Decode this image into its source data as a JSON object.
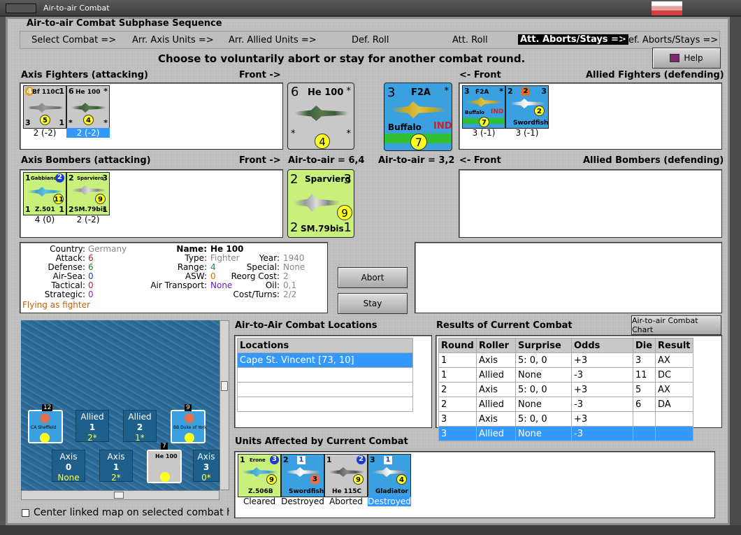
{
  "window": {
    "title": "Air-to-air Combat"
  },
  "sequence": {
    "title": "Air-to-air Combat Subphase Sequence",
    "steps": [
      "Select Combat =>",
      "Arr. Axis Units =>",
      "Arr. Allied Units =>",
      "Def. Roll",
      "Att. Roll",
      "Att. Aborts/Stays =>",
      "Def. Aborts/Stays =>"
    ],
    "active_index": 5
  },
  "prompt": "Choose to voluntarily abort or stay for another combat round.",
  "help_label": "Help",
  "axis_fighters": {
    "title": "Axis Fighters (attacking)",
    "front": "Front ->",
    "units": [
      {
        "name": "Bf 110C",
        "tl": "4",
        "tr": "1",
        "bl": "3",
        "br": "1",
        "dot": "5",
        "caption": "2 (-2)"
      },
      {
        "name": "He 100",
        "tl": "6",
        "tr": "*",
        "bl": "*",
        "br": "*",
        "dot": "4",
        "caption": "2 (-2)",
        "selected": true
      }
    ]
  },
  "allied_fighters": {
    "title": "Allied Fighters (defending)",
    "front": "<- Front",
    "units": [
      {
        "name": "F2A",
        "sub": "Buffalo",
        "tag": "IND",
        "tl": "3",
        "tr": "*",
        "dot": "7",
        "caption": "3 (-1)"
      },
      {
        "name": "Swordfish",
        "tl": "2",
        "tr": "3",
        "mid": "2",
        "dot": "2",
        "caption": "3 (-1)"
      }
    ]
  },
  "active_axis": {
    "name": "He 100",
    "tl": "6",
    "tr": "*",
    "bl": "*",
    "br": "*",
    "dot": "4",
    "odds_label": "Air-to-air = 6,4"
  },
  "active_allied": {
    "name": "F2A",
    "sub": "Buffalo",
    "tag": "IND",
    "tl": "3",
    "tr": "*",
    "dot": "7",
    "odds_label": "Air-to-air = 3,2"
  },
  "axis_bombers": {
    "title": "Axis Bombers (attacking)",
    "front": "Front ->",
    "units": [
      {
        "name": "Gabbiano",
        "sub": "Z.501",
        "tl": "1",
        "tr": "2",
        "bl": "1",
        "br": "1",
        "dot": "11",
        "caption": "4 (0)"
      },
      {
        "name": "Sparviero",
        "sub": "SM.79bis",
        "tl": "2",
        "tr": "3",
        "bl": "2",
        "br": "1",
        "dot": "9",
        "caption": "2 (-2)"
      }
    ]
  },
  "allied_bombers": {
    "title": "Allied Bombers (defending)",
    "front": "<- Front"
  },
  "active_bomber": {
    "name": "Sparviero",
    "sub": "SM.79bis",
    "tl": "2",
    "tr": "3",
    "bl": "2",
    "br": "1",
    "dot": "9"
  },
  "info": {
    "country_label": "Country:",
    "country": "Germany",
    "attack_label": "Attack:",
    "attack": "6",
    "defense_label": "Defense:",
    "defense": "6",
    "airsea_label": "Air-Sea:",
    "airsea": "0",
    "tactical_label": "Tactical:",
    "tactical": "0",
    "strategic_label": "Strategic:",
    "strategic": "0",
    "flying": "Flying as fighter",
    "name_label": "Name:",
    "name": "He 100",
    "type_label": "Type:",
    "type": "Fighter",
    "range_label": "Range:",
    "range": "4",
    "asw_label": "ASW:",
    "asw": "0",
    "transport_label": "Air Transport:",
    "transport": "None",
    "year_label": "Year:",
    "year": "1940",
    "special_label": "Special:",
    "special": "None",
    "reorg_label": "Reorg Cost:",
    "reorg": "2",
    "oil_label": "Oil:",
    "oil": "0,1",
    "cost_label": "Cost/Turns:",
    "cost": "2/2"
  },
  "abort_label": "Abort",
  "stay_label": "Stay",
  "map": {
    "hexes": [
      {
        "side": "Allied",
        "n": "1",
        "v": "2*"
      },
      {
        "side": "Allied",
        "n": "2",
        "v": "1*"
      },
      {
        "side": "Axis",
        "n": "0",
        "v": "None"
      },
      {
        "side": "Axis",
        "n": "1",
        "v": "2*"
      },
      {
        "side": "Axis",
        "n": "3",
        "v": "0*"
      }
    ],
    "ships": [
      {
        "name": "CA Sheffield",
        "stack": "12"
      },
      {
        "name": "BB Duke of York",
        "stack": "9"
      }
    ],
    "map_counter": {
      "name": "He 100",
      "stack": "7"
    },
    "center_label": "Center linked map on selected combat hex"
  },
  "locations": {
    "title": "Air-to-Air Combat Locations",
    "header": "Locations",
    "items": [
      "Cape St. Vincent [73, 10]"
    ]
  },
  "results": {
    "title": "Results of Current Combat",
    "chart_button": "Air-to-air Combat Chart",
    "columns": [
      "Round",
      "Roller",
      "Surprise",
      "Odds",
      "Die",
      "Result"
    ],
    "rows": [
      [
        "1",
        "Axis",
        "5: 0, 0",
        "+3",
        "3",
        "AX"
      ],
      [
        "1",
        "Allied",
        "None",
        "-3",
        "11",
        "DC"
      ],
      [
        "2",
        "Axis",
        "5: 0, 0",
        "+3",
        "5",
        "AX"
      ],
      [
        "2",
        "Allied",
        "None",
        "-3",
        "6",
        "DA"
      ],
      [
        "3",
        "Axis",
        "5: 0, 0",
        "+3",
        "",
        ""
      ],
      [
        "3",
        "Allied",
        "None",
        "-3",
        "",
        ""
      ]
    ],
    "selected_row": 5
  },
  "affected": {
    "title": "Units Affected by Current Combat",
    "units": [
      {
        "name": "Erone",
        "sub": "Z.506B",
        "tl": "1",
        "tr": "3",
        "dot": "9",
        "caption": "Cleared"
      },
      {
        "name": "Swordfish",
        "tl": "2",
        "tr": "1",
        "mid": "3",
        "caption": "Destroyed"
      },
      {
        "name": "He 115C",
        "tl": "1",
        "tr": "2",
        "dot": "9",
        "caption": "Aborted"
      },
      {
        "name": "Gladiator",
        "tl": "3",
        "tr": "1",
        "dot": "4",
        "caption": "Destroyed",
        "selected": true
      }
    ]
  },
  "colors": {
    "axis_counter": "#c8c8c8",
    "italy_counter": "#c8f07a",
    "allied_counter": "#3aa0e0",
    "selection": "#3399ff",
    "attack": "#c82020",
    "defense": "#208020",
    "airsea": "#2040c0",
    "asw": "#d07010",
    "transport": "#6020c0",
    "flying": "#c06000"
  }
}
